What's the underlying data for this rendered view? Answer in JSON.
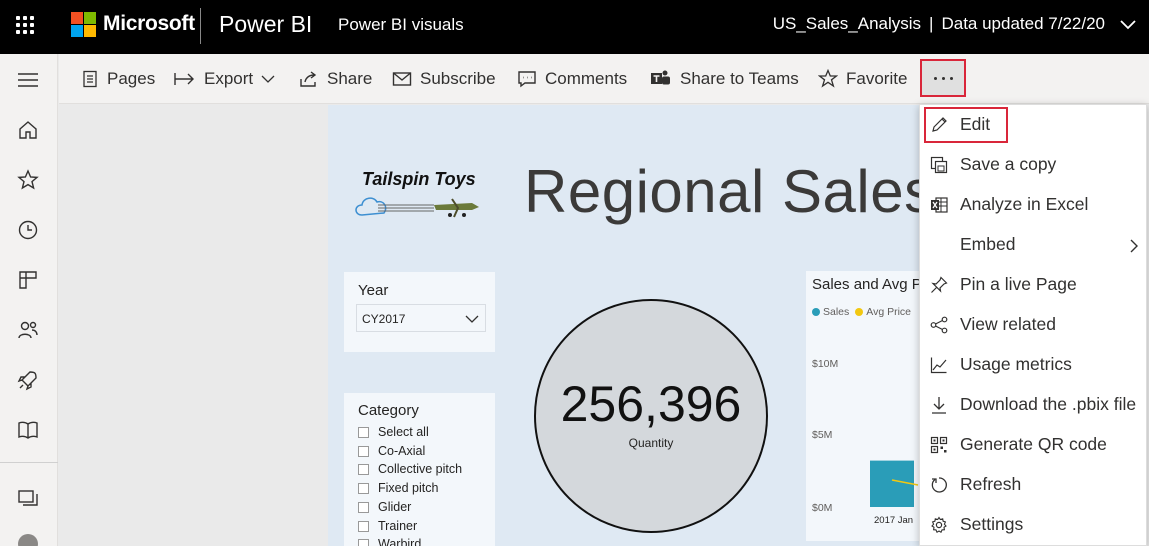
{
  "header": {
    "brand": "Microsoft",
    "product": "Power BI",
    "workspace": "Power BI visuals",
    "report_name": "US_Sales_Analysis",
    "separator": "|",
    "data_updated": "Data updated 7/22/20"
  },
  "actionbar": {
    "pages": "Pages",
    "export": "Export",
    "share": "Share",
    "subscribe": "Subscribe",
    "comments": "Comments",
    "share_teams": "Share to Teams",
    "favorite": "Favorite",
    "more": "···"
  },
  "menu": {
    "items": [
      {
        "label": "Edit",
        "icon": "pencil-icon"
      },
      {
        "label": "Save a copy",
        "icon": "save-copy-icon"
      },
      {
        "label": "Analyze in Excel",
        "icon": "excel-icon"
      },
      {
        "label": "Embed",
        "icon": "none"
      },
      {
        "label": "Pin a live Page",
        "icon": "pin-icon"
      },
      {
        "label": "View related",
        "icon": "share-nodes-icon"
      },
      {
        "label": "Usage metrics",
        "icon": "line-chart-icon"
      },
      {
        "label": "Download the .pbix file",
        "icon": "download-icon"
      },
      {
        "label": "Generate QR code",
        "icon": "qr-code-icon"
      },
      {
        "label": "Refresh",
        "icon": "refresh-icon"
      },
      {
        "label": "Settings",
        "icon": "gear-icon"
      }
    ]
  },
  "report": {
    "logo_text": "Tailspin Toys",
    "title": "Regional Sales A",
    "year_slicer": {
      "title": "Year",
      "selected": "CY2017"
    },
    "category_slicer": {
      "title": "Category",
      "options": [
        "Select all",
        "Co-Axial",
        "Collective pitch",
        "Fixed pitch",
        "Glider",
        "Trainer",
        "Warbird"
      ]
    },
    "kpi": {
      "value": "256,396",
      "label": "Quantity"
    },
    "chart": {
      "title": "Sales and Avg P",
      "legend": [
        {
          "name": "Sales",
          "color": "#2a9db8"
        },
        {
          "name": "Avg Price",
          "color": "#f2c811"
        }
      ],
      "yticks": [
        "$10M",
        "$5M",
        "$0M"
      ],
      "xticks": [
        "2017 Jan"
      ]
    }
  },
  "chart_data": {
    "type": "bar",
    "title": "Sales and Avg P",
    "categories": [
      "2017 Jan"
    ],
    "series": [
      {
        "name": "Sales",
        "values": [
          3.2
        ]
      },
      {
        "name": "Avg Price",
        "values": [
          null
        ]
      }
    ],
    "ylim": [
      0,
      10
    ],
    "yticks": [
      "$10M",
      "$5M",
      "$0M"
    ]
  },
  "colors": {
    "header_bg": "#000000",
    "accent_red": "#d9263a",
    "sales": "#2a9db8",
    "avg_price": "#f2c811"
  }
}
